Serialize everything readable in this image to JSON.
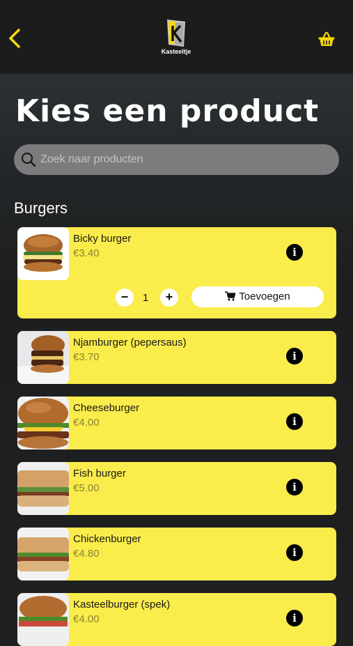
{
  "header": {
    "logo_text": "Kasteeltje",
    "back_icon": "chevron-left-icon",
    "basket_icon": "basket-icon",
    "accent_color": "#f5d90a"
  },
  "page_title": "Kies een product",
  "search": {
    "placeholder": "Zoek naar producten",
    "icon": "search-icon"
  },
  "section_title": "Burgers",
  "card_color": "#faec4b",
  "products": [
    {
      "name": "Bicky burger",
      "price": "€3.40",
      "quantity": "1",
      "add_label": "Toevoegen",
      "minus": "−",
      "plus": "+"
    },
    {
      "name": "Njamburger (pepersaus)",
      "price": "€3.70"
    },
    {
      "name": "Cheeseburger",
      "price": "€4.00"
    },
    {
      "name": "Fish burger",
      "price": "€5.00"
    },
    {
      "name": "Chickenburger",
      "price": "€4.80"
    },
    {
      "name": "Kasteelburger (spek)",
      "price": "€4.00"
    }
  ]
}
